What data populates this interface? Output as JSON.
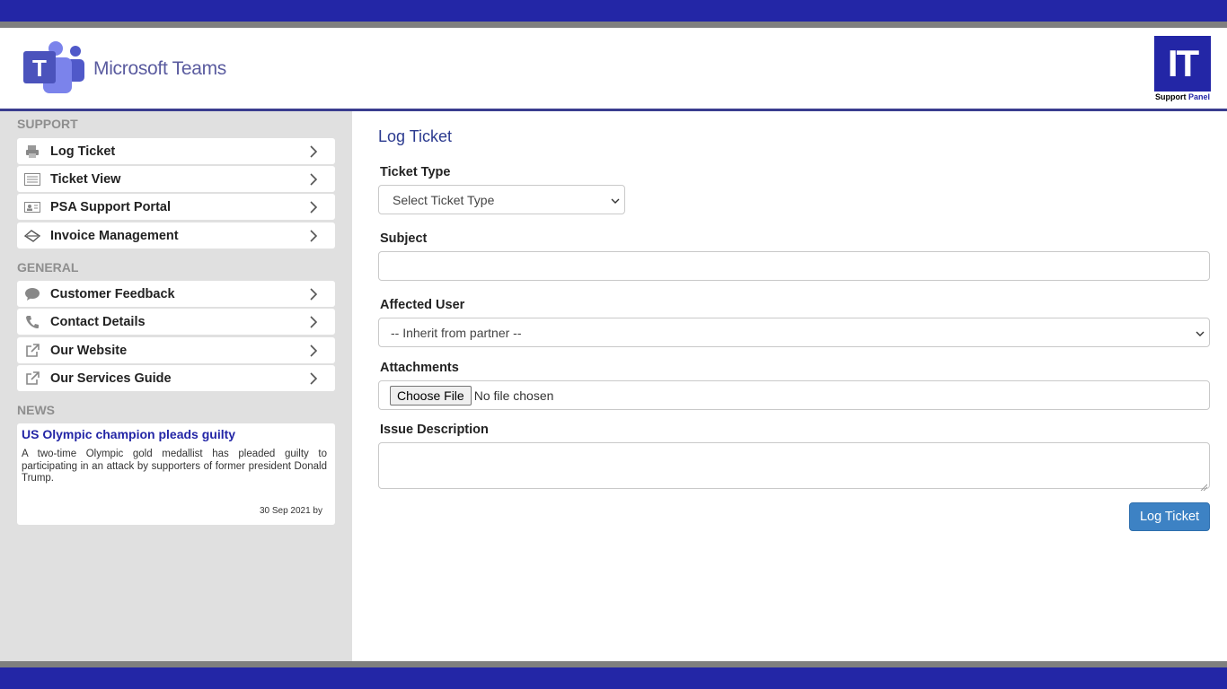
{
  "header": {
    "logo_text": "Microsoft Teams",
    "badge_big": "IT",
    "badge_caption_1": "Support",
    "badge_caption_2": "Panel"
  },
  "sidebar": {
    "support_title": "SUPPORT",
    "support_items": [
      {
        "label": "Log Ticket",
        "icon": "printer-icon"
      },
      {
        "label": "Ticket View",
        "icon": "list-icon"
      },
      {
        "label": "PSA Support Portal",
        "icon": "id-card-icon"
      },
      {
        "label": "Invoice Management",
        "icon": "invoice-icon"
      }
    ],
    "general_title": "GENERAL",
    "general_items": [
      {
        "label": "Customer Feedback",
        "icon": "speech-bubble-icon"
      },
      {
        "label": "Contact Details",
        "icon": "phone-icon"
      },
      {
        "label": "Our Website",
        "icon": "external-link-icon"
      },
      {
        "label": "Our Services Guide",
        "icon": "external-link-icon"
      }
    ],
    "news_title": "NEWS",
    "news": {
      "headline": "US Olympic champion pleads guilty",
      "body": "A two-time Olympic gold medallist has pleaded guilty to participating in an attack by supporters of former president Donald Trump.",
      "date": "30 Sep 2021 by"
    }
  },
  "form": {
    "page_title": "Log Ticket",
    "ticket_type_label": "Ticket Type",
    "ticket_type_value": "Select Ticket Type",
    "subject_label": "Subject",
    "subject_value": "",
    "affected_user_label": "Affected User",
    "affected_user_value": "-- Inherit from partner --",
    "attachments_label": "Attachments",
    "choose_file_label": "Choose File",
    "file_status": "No file chosen",
    "description_label": "Issue Description",
    "description_value": "",
    "submit_label": "Log Ticket"
  },
  "colors": {
    "brand_blue": "#2326a6",
    "button_blue": "#3d82c4",
    "sidebar_bg": "#e0e0e0",
    "title_blue": "#2b3a8f"
  }
}
